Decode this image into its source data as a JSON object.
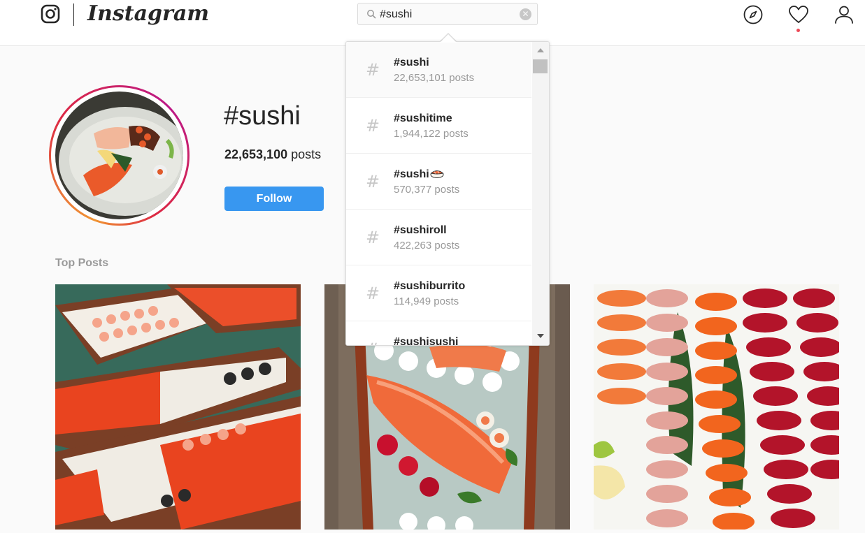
{
  "header": {
    "brand": "Instagram",
    "search": {
      "value": "#sushi",
      "placeholder": "Search"
    },
    "nav_icons": [
      "compass-icon",
      "heart-icon",
      "profile-icon"
    ],
    "activity_dot_color": "#ed4956"
  },
  "tag_page": {
    "title": "#sushi",
    "post_count": "22,653,100",
    "post_count_suffix": " posts",
    "follow_label": "Follow",
    "top_posts_label": "Top Posts"
  },
  "search_dropdown": {
    "results": [
      {
        "name": "#sushi",
        "count": "22,653,101 posts",
        "emoji": ""
      },
      {
        "name": "#sushitime",
        "count": "1,944,122 posts",
        "emoji": ""
      },
      {
        "name": "#sushi",
        "count": "570,377 posts",
        "emoji": "sushi-emoji"
      },
      {
        "name": "#sushiroll",
        "count": "422,263 posts",
        "emoji": ""
      },
      {
        "name": "#sushiburrito",
        "count": "114,949 posts",
        "emoji": ""
      },
      {
        "name": "#sushisushi",
        "count": "",
        "emoji": ""
      }
    ]
  },
  "colors": {
    "accent": "#3897f0",
    "text": "#262626",
    "secondary_text": "#999999",
    "background": "#fafafa"
  }
}
